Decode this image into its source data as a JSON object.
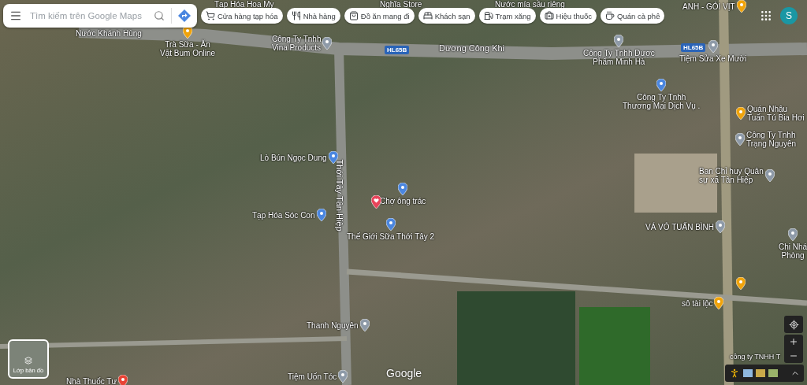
{
  "search": {
    "placeholder": "Tìm kiếm trên Google Maps"
  },
  "chips": [
    {
      "kind": "cart",
      "label": "Cửa hàng tạp hóa"
    },
    {
      "kind": "restaurant",
      "label": "Nhà hàng"
    },
    {
      "kind": "takeout",
      "label": "Đồ ăn mang đi"
    },
    {
      "kind": "hotel",
      "label": "Khách sạn"
    },
    {
      "kind": "gas",
      "label": "Trạm xăng"
    },
    {
      "kind": "pharmacy",
      "label": "Hiệu thuốc"
    },
    {
      "kind": "cafe",
      "label": "Quán cà phê"
    }
  ],
  "account": {
    "initial": "S"
  },
  "roads": [
    {
      "kind": "shield",
      "label": "HL65B"
    },
    {
      "kind": "name",
      "label": "Dương Công Khi"
    },
    {
      "kind": "shield",
      "label": "HL65B"
    },
    {
      "kind": "vertical",
      "label": "Thới Tây Tân Hiệp"
    }
  ],
  "places": [
    {
      "kind": "none",
      "lines": [
        "Tạp Hóa Hoa My"
      ]
    },
    {
      "kind": "none",
      "lines": [
        "Nghĩa Store"
      ]
    },
    {
      "kind": "none",
      "lines": [
        "Nước mía sầu riêng"
      ]
    },
    {
      "kind": "food",
      "lines": [
        "ANH - GỎI VỊT"
      ]
    },
    {
      "kind": "none",
      "lines": [
        "Nước Khánh Hùng"
      ]
    },
    {
      "kind": "food",
      "lines": [
        "Trà Sữa - Ăn",
        "Vặt Bum Online"
      ]
    },
    {
      "kind": "place",
      "lines": [
        "Công Ty Tnhh",
        "Vina Products"
      ]
    },
    {
      "kind": "place",
      "lines": [
        "Công Ty Tnhh Dược",
        "Phẩm Minh Hà"
      ]
    },
    {
      "kind": "place",
      "lines": [
        "Tiệm Sửa Xe Mười"
      ]
    },
    {
      "kind": "shop",
      "lines": [
        "Công Ty Tnhh",
        "Thương Mại Dịch Vụ ."
      ]
    },
    {
      "kind": "food",
      "lines": [
        "Quán Nhậu",
        "Tuấn Tú Bia Hơi"
      ]
    },
    {
      "kind": "place",
      "lines": [
        "Công Ty Tnhh",
        "Trạng Nguyên"
      ]
    },
    {
      "kind": "place",
      "lines": [
        "Ban Chỉ huy Quân",
        "sự xã Tân Hiệp"
      ]
    },
    {
      "kind": "shop",
      "lines": [
        "Lò Bún Ngọc Dung"
      ]
    },
    {
      "kind": "shop",
      "lines": [
        "Chợ ông trác"
      ]
    },
    {
      "kind": "shop",
      "lines": [
        "Tạp Hóa Sóc Con"
      ]
    },
    {
      "kind": "shop",
      "lines": [
        "Thế Giới Sữa Thới Tây 2"
      ]
    },
    {
      "kind": "place",
      "lines": [
        "VÁ VỎ TUẤN BÌNH"
      ]
    },
    {
      "kind": "place",
      "lines": [
        "Chi Nhá",
        "Phòng"
      ]
    },
    {
      "kind": "cafe",
      "lines": [
        "sô tài lộc"
      ]
    },
    {
      "kind": "place",
      "lines": [
        "Thanh Nguyên"
      ]
    },
    {
      "kind": "place",
      "lines": [
        "Tiệm Uốn Tóc"
      ]
    },
    {
      "kind": "none",
      "lines": [
        "công ty TNHH T"
      ]
    },
    {
      "kind": "red",
      "lines": [
        "Nhà Thuốc Tư"
      ]
    }
  ],
  "layers": {
    "label": "Lớp bản đồ"
  },
  "logo": "Google"
}
